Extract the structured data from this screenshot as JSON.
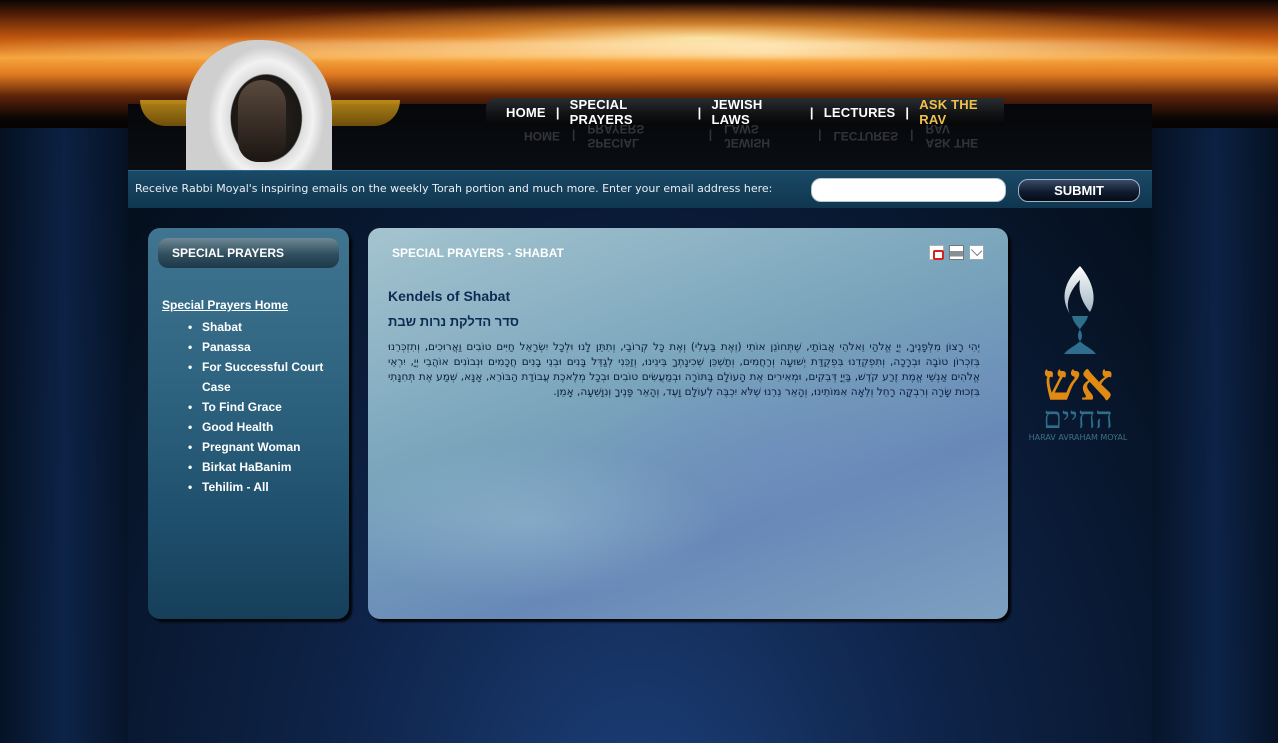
{
  "nav": {
    "items": [
      "HOME",
      "SPECIAL PRAYERS",
      "JEWISH LAWS",
      "LECTURES",
      "ASK THE RAV"
    ]
  },
  "email_signup": {
    "text": "Receive Rabbi Moyal's inspiring emails on the weekly Torah portion and much more. Enter your email address here:",
    "placeholder": "",
    "submit_label": "SUBMIT"
  },
  "sidebar": {
    "title": "SPECIAL PRAYERS",
    "home_link": "Special Prayers Home",
    "items": [
      "Shabat",
      "Panassa",
      "For Successful Court Case",
      "To Find Grace",
      "Good Health",
      "Pregnant Woman",
      "Birkat HaBanim",
      "Tehilim - All"
    ]
  },
  "main": {
    "header": "SPECIAL PRAYERS - SHABAT",
    "title": "Kendels of Shabat",
    "subtitle": "סדר הדלקת נרות שבת",
    "body": "יְהִי רָצוֹן מִלְּפָנֶיךָ, יְיָ אֱלֹהַי וֵאלֹהֵי אֲבוֹתַי, שֶׁתְּחוֹנֵן אוֹתִי (וְאֶת בַּעְלִי) וְאֶת כָּל קְרוֹבַי, וְתִתֵּן לָנוּ וּלְכָל יִשְׂרָאֵל חַיִּים טוֹבִים וַאֲרוּכִים, וְתִזְכְּרֵנוּ בְּזִכְרוֹן טוֹבָה וּבְרָכָה, וְתִפְקְדֵנוּ בִּפְקֻדַּת יְשׁוּעָה וְרַחֲמִים, וְתַשְׁכֵּן שְׁכִינָתְךָ בֵּינֵינוּ, וְזַכֵּנִי לְגַדֵּל בָּנִים וּבְנֵי בָנִים חֲכָמִים וּנְבוֹנִים אוֹהֲבֵי יְיָ, יִרְאֵי אֱלֹהִים אַנְשֵׁי אֱמֶת זֶרַע קֹדֶשׁ, בַּיְיָ דְּבֵקִים, וּמְאִירִים אֶת הָעוֹלָם בַּתּוֹרָה וּבְמַעֲשִׂים טוֹבִים וּבְכָל מְלֶאכֶת עֲבוֹדַת הַבּוֹרֵא, אָנָּא, שְׁמַע אֶת תְּחִנָּתִי בִּזְכוּת שָׂרָה וְרִבְקָה רָחֵל וְלֵאָה אִמּוֹתֵינוּ, וְהָאֵר נֵרֵנוּ שֶׁלֹּא יִכְבֶּה לְעוֹלָם וָעֶד, וְהָאֵר פָּנֶיךָ וְנִוָּשֵׁעָה, אָמֵן."
  },
  "logo": {
    "hebrew_top": "אש",
    "hebrew_bottom": "החיים",
    "credit": "HARAV AVRAHAM MOYAL"
  },
  "colors": {
    "nav_highlight": "#f2c04a",
    "sidebar_bg": "#2e6480",
    "main_title": "#0f2a52",
    "logo_gold": "#e08a14",
    "logo_teal": "#2d6f8c"
  }
}
